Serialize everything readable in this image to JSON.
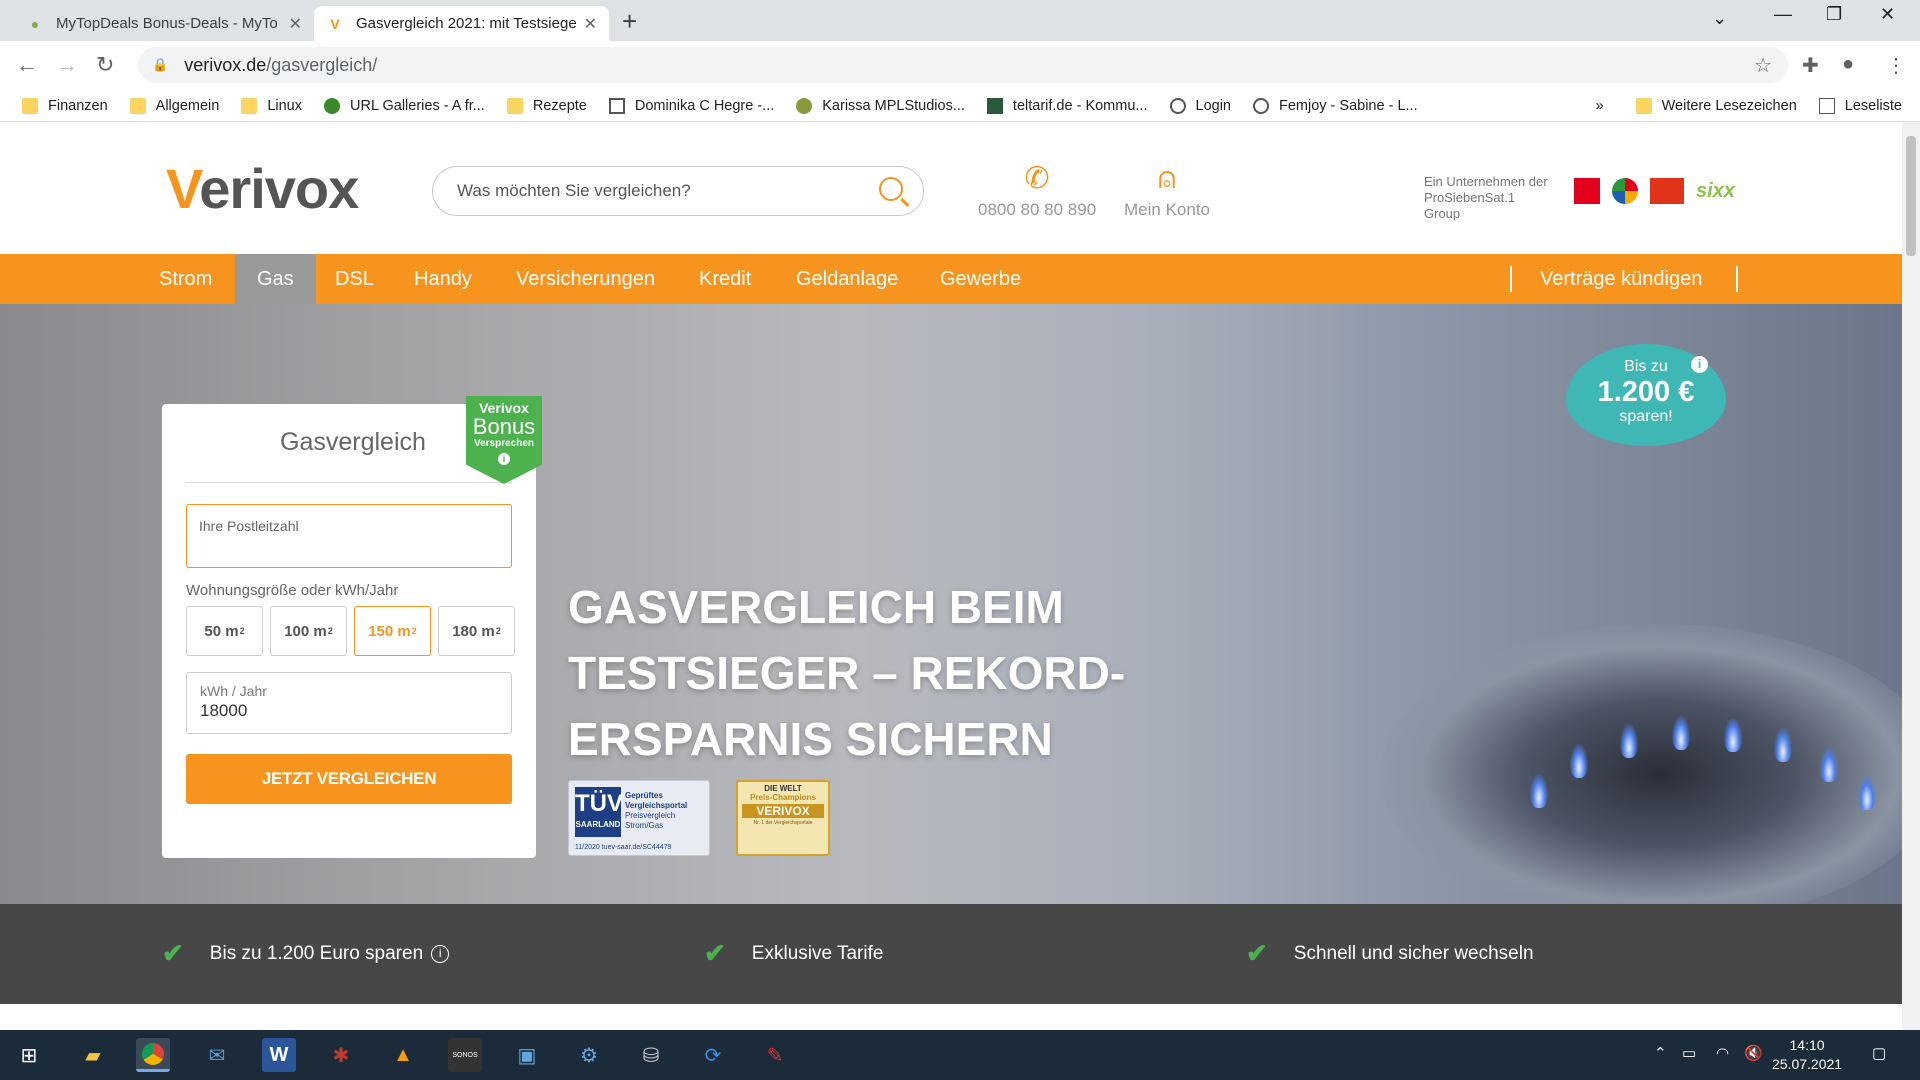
{
  "browser": {
    "tabs": [
      {
        "title": "MyTopDeals Bonus-Deals - MyTo",
        "active": false
      },
      {
        "title": "Gasvergleich 2021: mit Testsieger",
        "active": true
      }
    ],
    "url_host": "verivox.de",
    "url_path": "/gasvergleich/",
    "bookmarks": [
      {
        "label": "Finanzen",
        "icon": "folder-icon"
      },
      {
        "label": "Allgemein",
        "icon": "folder-icon"
      },
      {
        "label": "Linux",
        "icon": "folder-icon"
      },
      {
        "label": "URL Galleries - A fr...",
        "icon": "site-icon"
      },
      {
        "label": "Rezepte",
        "icon": "folder-icon"
      },
      {
        "label": "Dominika C Hegre -...",
        "icon": "site-icon"
      },
      {
        "label": "Karissa MPLStudios...",
        "icon": "site-icon"
      },
      {
        "label": "teltarif.de - Kommu...",
        "icon": "site-icon"
      },
      {
        "label": "Login",
        "icon": "globe-icon"
      },
      {
        "label": "Femjoy - Sabine - L...",
        "icon": "globe-icon"
      }
    ],
    "bookmarks_overflow": "»",
    "other_bookmarks": "Weitere Lesezeichen",
    "reading_list": "Leseliste"
  },
  "site": {
    "logo_v": "V",
    "logo_rest": "erivox",
    "search_placeholder": "Was möchten Sie vergleichen?",
    "phone": "0800 80 80 890",
    "account": "Mein Konto",
    "group_text": "Ein Unternehmen der ProSiebenSat.1 Group",
    "nav": [
      "Strom",
      "Gas",
      "DSL",
      "Handy",
      "Versicherungen",
      "Kredit",
      "Geldanlage",
      "Gewerbe"
    ],
    "nav_active": "Gas",
    "nav_right": "Verträge kündigen"
  },
  "hero": {
    "save_badge": {
      "line1": "Bis zu",
      "amount": "1.200 €",
      "line3": "sparen!"
    },
    "headline": "GASVERGLEICH BEIM TESTSIEGER – REKORD-ERSPARNIS SICHERN",
    "tuv": {
      "brand": "TÜV",
      "sub": "SAARLAND",
      "text1": "Geprüftes",
      "text2": "Vergleichsportal",
      "text3": "Preisvergleich Strom/Gas",
      "footer": "11/2020   tuev-saar.de/SC44479"
    },
    "welt": {
      "top": "DIE WELT",
      "sub": "Preis-Champions",
      "brand": "VERIVOX",
      "small": "Nr. 1 der Vergleichsportale"
    }
  },
  "form": {
    "title": "Gasvergleich",
    "bonus": {
      "l1": "Verivox",
      "l2": "Bonus",
      "l3": "Versprechen"
    },
    "zip_placeholder": "Ihre Postleitzahl",
    "size_label": "Wohnungsgröße oder kWh/Jahr",
    "sizes": [
      "50 m",
      "100 m",
      "150 m",
      "180 m"
    ],
    "selected_size": "150 m",
    "kwh_label": "kWh / Jahr",
    "kwh_value": "18000",
    "cta": "JETZT VERGLEICHEN"
  },
  "benefits": [
    "Bis zu 1.200 Euro sparen",
    "Exklusive Tarife",
    "Schnell und sicher wechseln"
  ],
  "taskbar": {
    "time": "14:10",
    "date": "25.07.2021"
  },
  "colors": {
    "brand_orange": "#f7941d",
    "nav_active": "#999999",
    "bonus_green": "#4db24d",
    "badge_teal": "#3fb7b5"
  }
}
